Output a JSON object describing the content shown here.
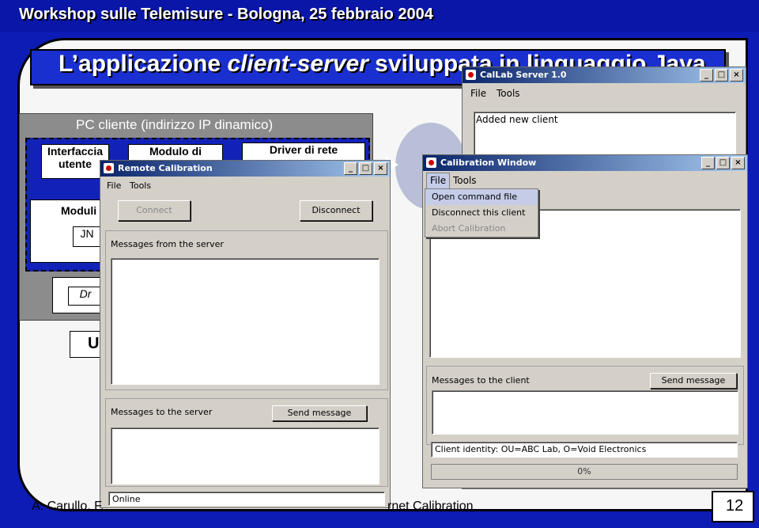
{
  "slide": {
    "header": "Workshop sulle Telemisure - Bologna, 25 febbraio 2004",
    "title_prefix": "L’applicazione ",
    "title_italic": "client-server",
    "title_suffix": " sviluppata in linguaggio Java",
    "footer_left": "A. Carullo, F.",
    "footer_mid": "rnet Calibration",
    "slide_number": "12"
  },
  "diagram": {
    "pc_label": "PC cliente (indirizzo IP dinamico)",
    "box_interface": "Interfaccia utente",
    "box_module": "Modulo di",
    "box_driver": "Driver di rete",
    "box_moduli": "Moduli",
    "box_jn": "JN",
    "box_dr": "Dr",
    "box_u": "U"
  },
  "callab_server": {
    "title": "CalLab Server 1.0",
    "menu": [
      "File",
      "Tools"
    ],
    "log_text": "Added new client"
  },
  "calibration_window": {
    "title": "Calibration Window",
    "menu": [
      "File",
      "Tools"
    ],
    "dropdown": [
      {
        "label": "Open command file",
        "state": "highlighted"
      },
      {
        "label": "Disconnect this client",
        "state": "normal"
      },
      {
        "label": "Abort Calibration",
        "state": "disabled"
      }
    ],
    "messages_to_client_label": "Messages to the client",
    "send_button": "Send message",
    "client_identity": "Client identity:  OU=ABC Lab, O=Void Electronics",
    "progress_text": "0%",
    "progress_value": 0
  },
  "remote_calibration": {
    "title": "Remote Calibration",
    "menu": [
      "File",
      "Tools"
    ],
    "connect_button": "Connect",
    "disconnect_button": "Disconnect",
    "messages_from_server_label": "Messages from the server",
    "messages_to_server_label": "Messages to the server",
    "send_button": "Send message",
    "status": "Online"
  }
}
